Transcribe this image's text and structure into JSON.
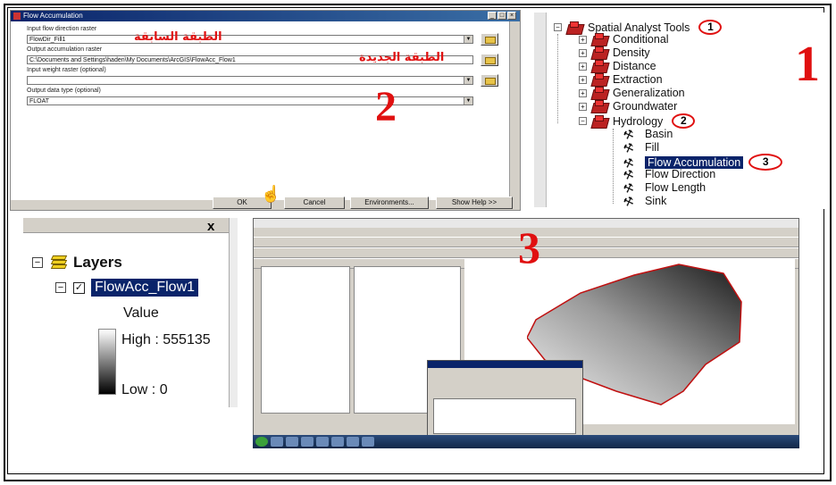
{
  "dialog": {
    "input_flow_label": "Input flow direction raster",
    "input_flow_value": "FlowDir_Fill1",
    "input_flow_arabic": "الطبقة السابقة",
    "output_label": "Output accumulation raster",
    "output_value": "C:\\Documents and Settings\\haden\\My Documents\\ArcGIS\\FlowAcc_Flow1",
    "output_arabic": "الطبقة الجديدة",
    "weight_label": "Input weight raster (optional)",
    "datatype_label": "Output data type (optional)",
    "datatype_value": "FLOAT",
    "ok_label": "OK",
    "cancel_label": "Cancel",
    "env_label": "Environments...",
    "help_label": "Show Help >>",
    "step_number": "2"
  },
  "toolbox": {
    "root": "Spatial Analyst Tools",
    "root_step": "1",
    "items": [
      "Conditional",
      "Density",
      "Distance",
      "Extraction",
      "Generalization",
      "Groundwater"
    ],
    "hydrology": "Hydrology",
    "hydrology_step": "2",
    "hydro_tools": [
      "Basin",
      "Fill",
      "Flow Accumulation",
      "Flow Direction",
      "Flow Length",
      "Sink"
    ],
    "selected_step": "3",
    "step_number": "1"
  },
  "layers": {
    "title": "Layers",
    "layer_name": "FlowAcc_Flow1",
    "value_label": "Value",
    "high_label": "High : 555135",
    "low_label": "Low : 0",
    "close": "x"
  },
  "arcmap": {
    "step_number": "3"
  }
}
